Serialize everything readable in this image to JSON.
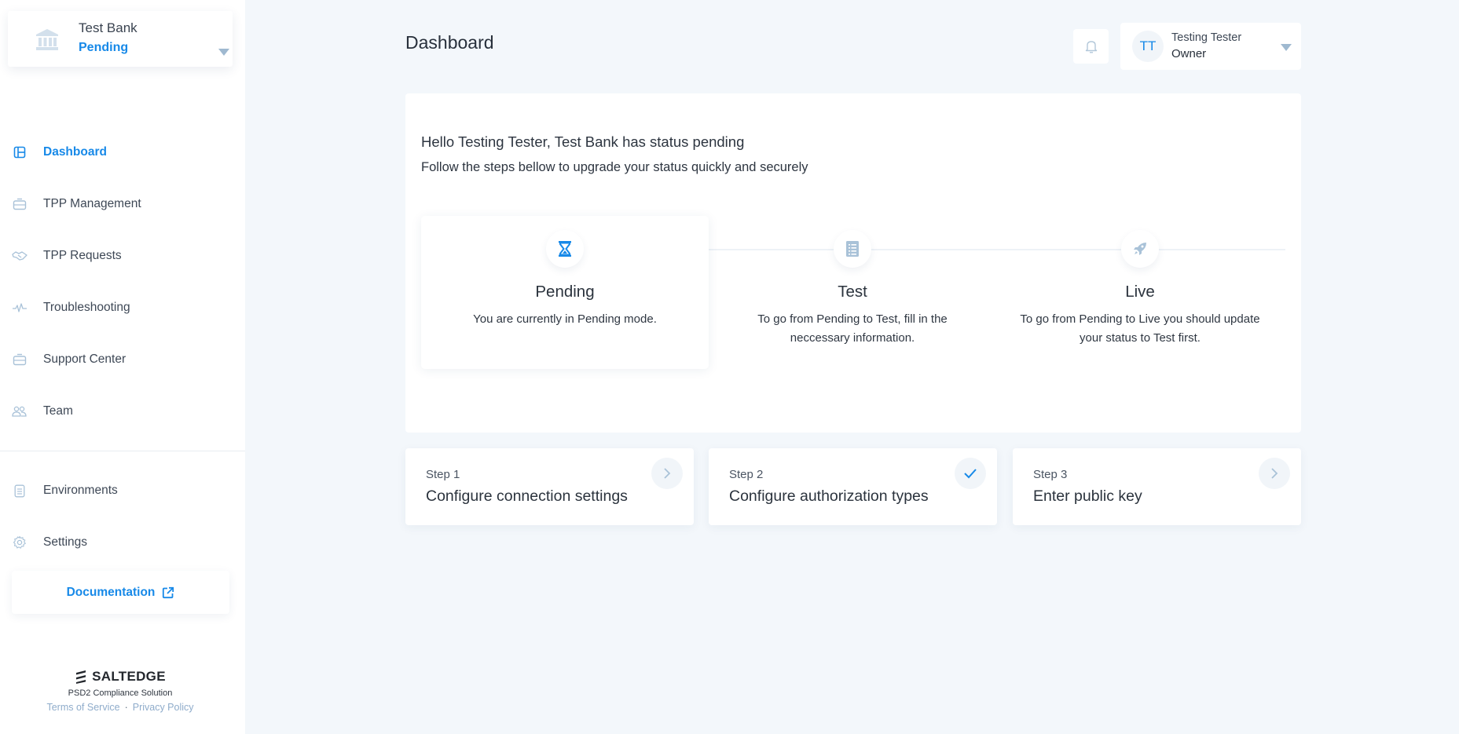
{
  "org": {
    "name": "Test Bank",
    "status": "Pending",
    "icon": "bank-icon"
  },
  "sidebar": {
    "items": [
      {
        "label": "Dashboard",
        "icon": "dashboard-icon",
        "active": true
      },
      {
        "label": "TPP Management",
        "icon": "briefcase-icon",
        "active": false
      },
      {
        "label": "TPP Requests",
        "icon": "handshake-icon",
        "active": false
      },
      {
        "label": "Troubleshooting",
        "icon": "pulse-icon",
        "active": false
      },
      {
        "label": "Support Center",
        "icon": "briefcase-icon",
        "active": false
      },
      {
        "label": "Team",
        "icon": "team-icon",
        "active": false
      }
    ],
    "secondary_items": [
      {
        "label": "Environments",
        "icon": "document-icon"
      },
      {
        "label": "Settings",
        "icon": "gear-icon"
      }
    ],
    "documentation": {
      "label": "Documentation",
      "icon": "external-link-icon"
    },
    "brand": {
      "name": "SALTEDGE",
      "tagline": "PSD2 Compliance Solution",
      "terms": "Terms of Service",
      "separator": "·",
      "privacy": "Privacy Policy"
    }
  },
  "header": {
    "title": "Dashboard",
    "notifications_icon": "bell-icon",
    "user": {
      "initials": "TT",
      "name": "Testing Tester",
      "role": "Owner"
    }
  },
  "status_panel": {
    "greeting": "Hello Testing Tester, Test Bank has status pending",
    "subtitle": "Follow the steps bellow to upgrade your status quickly and securely",
    "stages": [
      {
        "title": "Pending",
        "description": "You are currently in Pending mode.",
        "icon": "hourglass-icon",
        "current": true
      },
      {
        "title": "Test",
        "description": "To go from Pending to Test, fill in the neccessary information.",
        "icon": "list-icon",
        "current": false
      },
      {
        "title": "Live",
        "description": "To go from Pending to Live you should update your status to Test first.",
        "icon": "rocket-icon",
        "current": false
      }
    ]
  },
  "steps": [
    {
      "number": "Step 1",
      "title": "Configure connection settings",
      "state": "todo",
      "icon": "chevron-right-icon"
    },
    {
      "number": "Step 2",
      "title": "Configure authorization types",
      "state": "done",
      "icon": "check-icon"
    },
    {
      "number": "Step 3",
      "title": "Enter public key",
      "state": "todo",
      "icon": "chevron-right-icon"
    }
  ],
  "colors": {
    "accent": "#1789e8",
    "background": "#f3f7fb",
    "icon_muted": "#a9c2d8"
  }
}
